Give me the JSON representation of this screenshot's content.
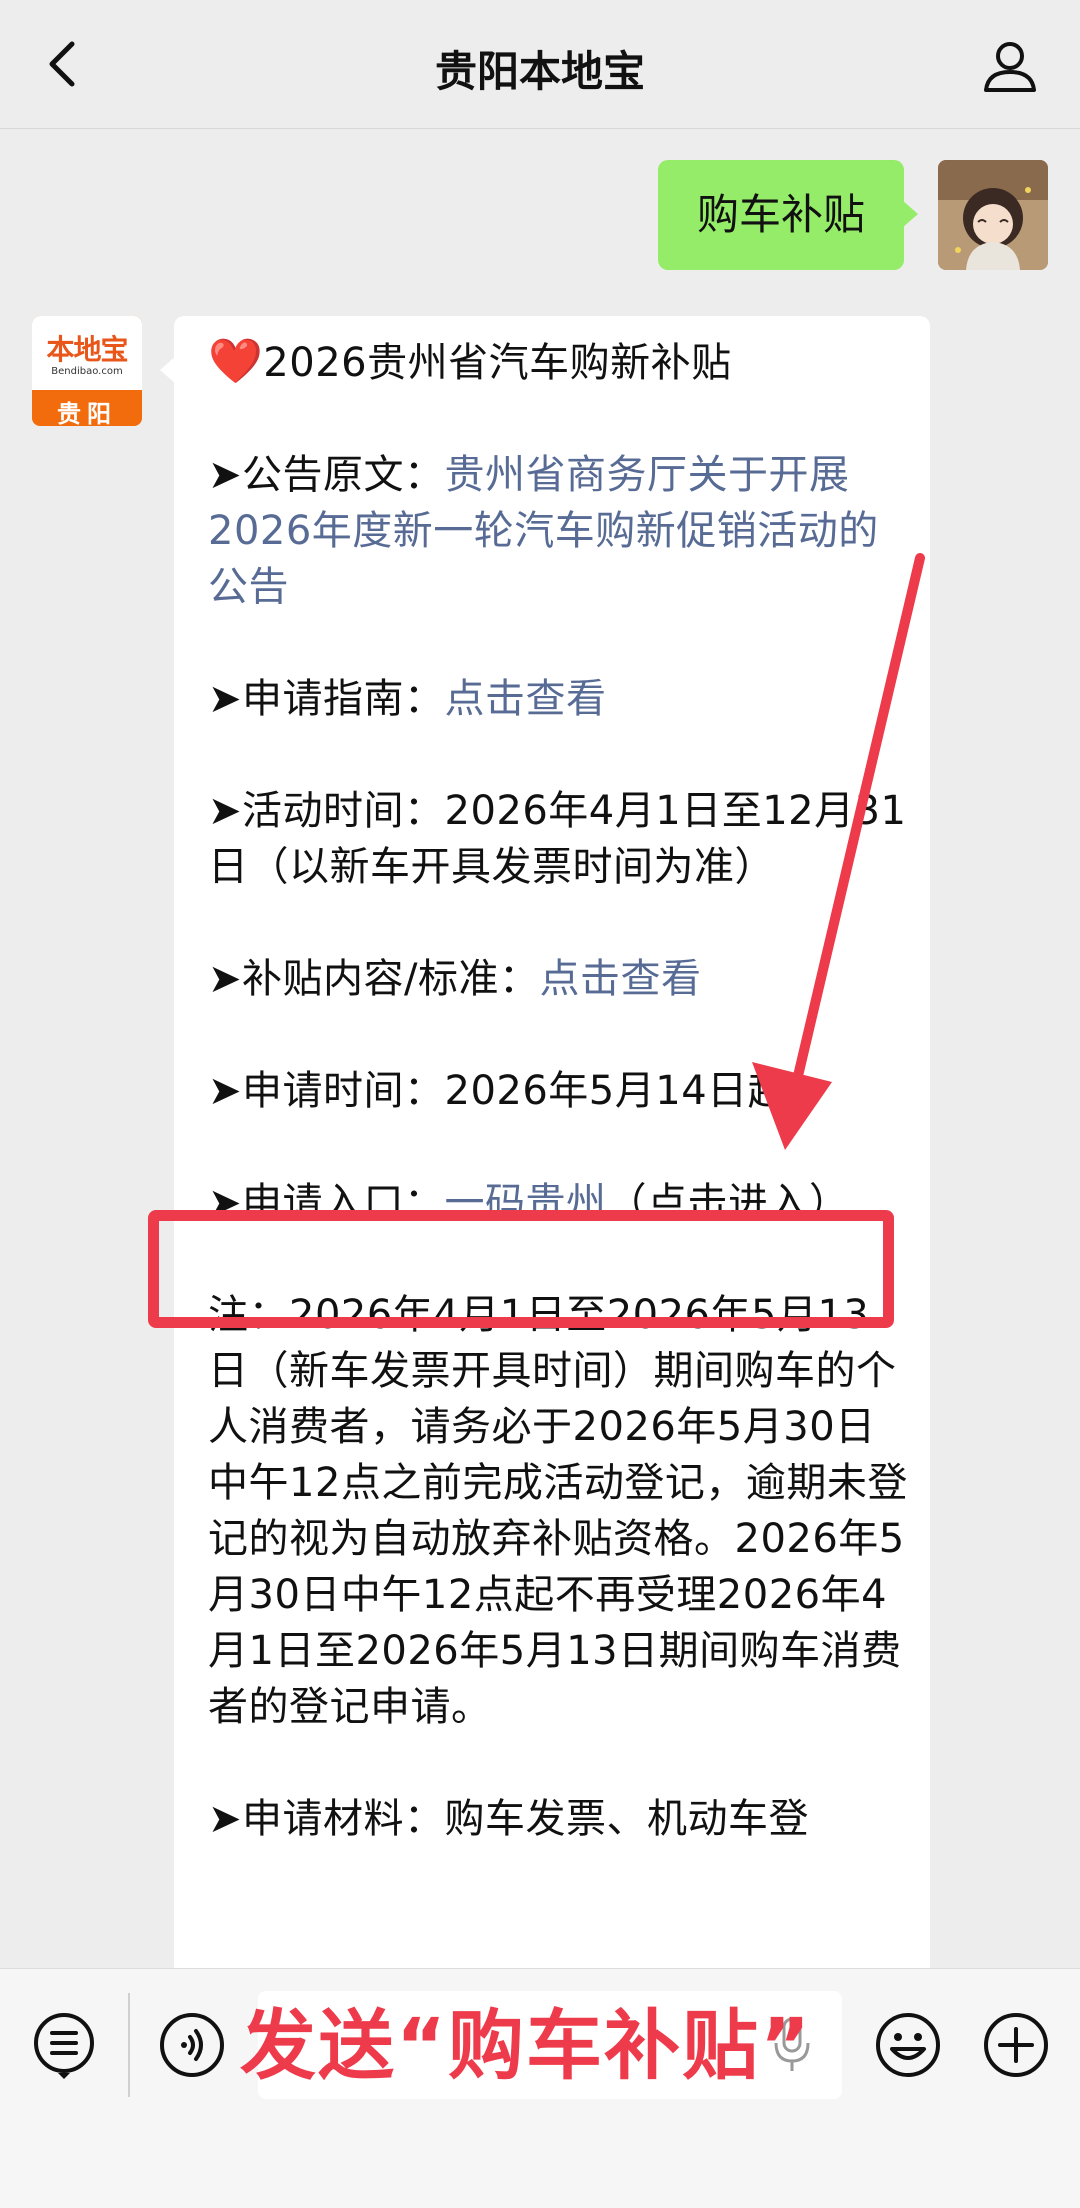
{
  "header": {
    "title": "贵阳本地宝",
    "back_icon": "chevron-left-icon",
    "profile_icon": "person-icon"
  },
  "sent_message": {
    "text": "购车补贴"
  },
  "bot_avatar": {
    "logo_text": "本地宝",
    "logo_domain": "Bendibao.com",
    "city": "贵阳"
  },
  "received_message": {
    "title_emoji": "❤️",
    "title": "2026贵州省汽车购新补贴",
    "announcement_label": "➤公告原文：",
    "announcement_link": "贵州省商务厅关于开展2026年度新一轮汽车购新促销活动的公告",
    "guide_label": "➤申请指南：",
    "guide_link": "点击查看",
    "activity_time": "➤活动时间：2026年4月1日至12月31日（以新车开具发票时间为准）",
    "subsidy_label": "➤补贴内容/标准：",
    "subsidy_link": "点击查看",
    "apply_time": "➤申请时间：2026年5月14日起",
    "entry_label": "➤申请入口：",
    "entry_link": "一码贵州",
    "entry_suffix": "（点击进入）",
    "note": "注：2026年4月1日至2026年5月13日（新车发票开具时间）期间购车的个人消费者，请务必于2026年5月30日中午12点之前完成活动登记，逾期未登记的视为自动放弃补贴资格。2026年5月30日中午12点起不再受理2026年4月1日至2026年5月13日期间购车消费者的登记申请。",
    "materials": "➤申请材料：购车发票、机动车登"
  },
  "annotation": {
    "overlay_text": "发送“购车补贴”",
    "color": "#ee3b4b"
  },
  "bottom_bar": {
    "menu_icon": "list-menu-icon",
    "voice_icon": "voice-icon",
    "mic_icon": "microphone-icon",
    "emoji_icon": "smiley-icon",
    "plus_icon": "plus-circle-icon"
  },
  "colors": {
    "sent_bubble": "#95ec69",
    "link": "#576b95",
    "background": "#ededed"
  }
}
